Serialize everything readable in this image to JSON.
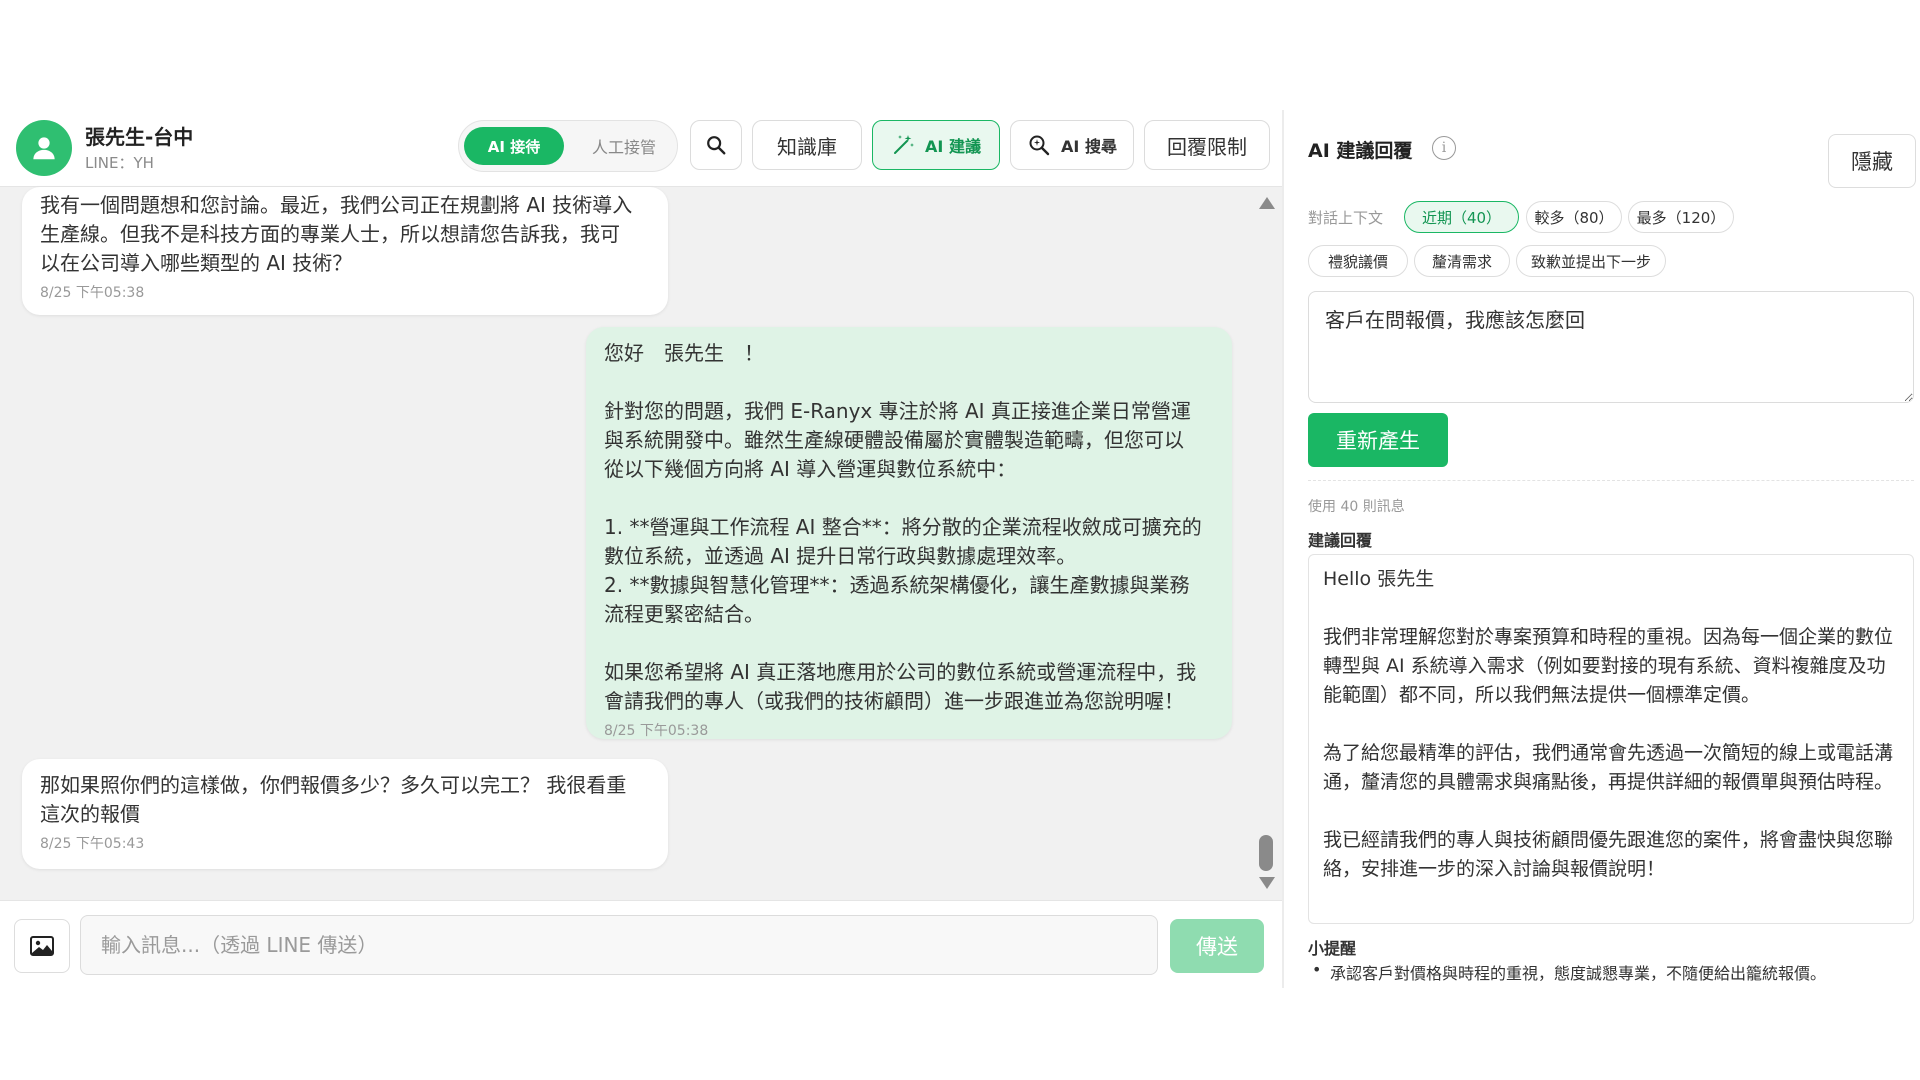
{
  "contact": {
    "name": "張先生-台中",
    "subtitle": "LINE：YH"
  },
  "mode_toggle": {
    "ai_label": "AI 接待",
    "human_label": "人工接管"
  },
  "toolbar": {
    "knowledge_label": "知識庫",
    "ai_suggest_label": "AI 建議",
    "ai_search_label": "AI 搜尋",
    "reply_limit_label": "回覆限制"
  },
  "messages": [
    {
      "direction": "in",
      "text": "我有一個問題想和您討論。最近，我們公司正在規劃將 AI 技術導入\n生產線。但我不是科技方面的專業人士，所以想請您告訴我，我可\n以在公司導入哪些類型的 AI 技術？",
      "time": "8/25 下午05:38"
    },
    {
      "direction": "out",
      "text": "您好　張先生　！\n\n針對您的問題，我們 E-Ranyx 專注於將 AI 真正接進企業日常營運\n與系統開發中。雖然生產線硬體設備屬於實體製造範疇，但您可以\n從以下幾個方向將 AI 導入營運與數位系統中：\n\n1. **營運與工作流程 AI 整合**：將分散的企業流程收斂成可擴充的\n數位系統，並透過 AI 提升日常行政與數據處理效率。\n2. **數據與智慧化管理**：透過系統架構優化，讓生產數據與業務\n流程更緊密結合。\n\n如果您希望將 AI 真正落地應用於公司的數位系統或營運流程中，我\n會請我們的專人（或我們的技術顧問）進一步跟進並為您說明喔！",
      "time": "8/25 下午05:38"
    },
    {
      "direction": "in",
      "text": "那如果照你們的這樣做，你們報價多少？多久可以完工？ 我很看重\n這次的報價",
      "time": "8/25 下午05:43"
    }
  ],
  "composer": {
    "placeholder": "輸入訊息...（透過 LINE 傳送）",
    "send_label": "傳送"
  },
  "ai_panel": {
    "title": "AI 建議回覆",
    "hide_label": "隱藏",
    "context_label": "對話上下文",
    "context_options": [
      {
        "label": "近期（40）",
        "active": true
      },
      {
        "label": "較多（80）",
        "active": false
      },
      {
        "label": "最多（120）",
        "active": false
      }
    ],
    "presets": [
      "禮貌議價",
      "釐清需求",
      "致歉並提出下一步"
    ],
    "prompt_value": "客戶在問報價，我應該怎麼回",
    "regenerate_label": "重新產生",
    "usage_text": "使用 40 則訊息",
    "suggestion_label": "建議回覆",
    "suggestion_paragraphs": [
      "Hello 張先生",
      "我們非常理解您對於專案預算和時程的重視。因為每一個企業的數位轉型與 AI 系統導入需求（例如要對接的現有系統、資料複雜度及功能範圍）都不同，所以我們無法提供一個標準定價。",
      "為了給您最精準的評估，我們通常會先透過一次簡短的線上或電話溝通，釐清您的具體需求與痛點後，再提供詳細的報價單與預估時程。",
      "我已經請我們的專人與技術顧問優先跟進您的案件，將會盡快與您聯絡，安排進一步的深入討論與報價說明！"
    ],
    "tips_label": "小提醒",
    "tips": [
      "承認客戶對價格與時程的重視，態度誠懇專業，不隨便給出籠統報價。"
    ]
  },
  "colors": {
    "accent": "#1ab764",
    "accent_light": "#e9f8ef",
    "outgoing_bubble": "#dff3e6",
    "chat_bg": "#f1f1f1"
  }
}
